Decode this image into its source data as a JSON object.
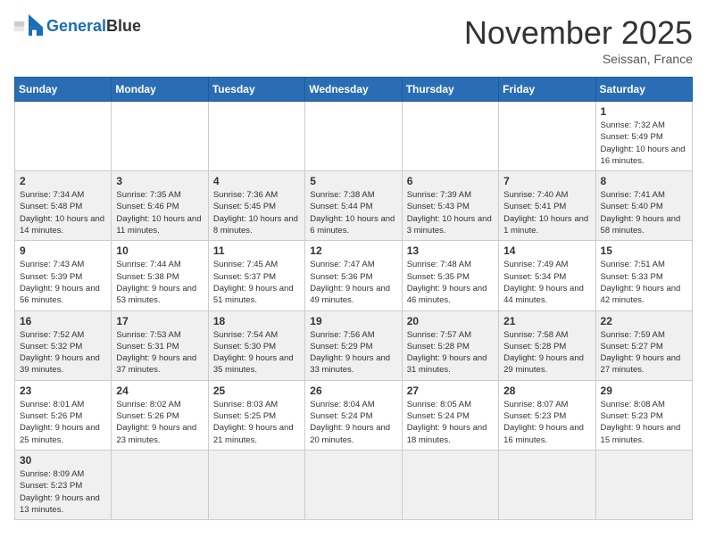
{
  "logo": {
    "general": "General",
    "blue": "Blue"
  },
  "title": "November 2025",
  "location": "Seissan, France",
  "days_of_week": [
    "Sunday",
    "Monday",
    "Tuesday",
    "Wednesday",
    "Thursday",
    "Friday",
    "Saturday"
  ],
  "weeks": [
    [
      {
        "day": "",
        "info": ""
      },
      {
        "day": "",
        "info": ""
      },
      {
        "day": "",
        "info": ""
      },
      {
        "day": "",
        "info": ""
      },
      {
        "day": "",
        "info": ""
      },
      {
        "day": "",
        "info": ""
      },
      {
        "day": "1",
        "info": "Sunrise: 7:32 AM\nSunset: 5:49 PM\nDaylight: 10 hours and 16 minutes."
      }
    ],
    [
      {
        "day": "2",
        "info": "Sunrise: 7:34 AM\nSunset: 5:48 PM\nDaylight: 10 hours and 14 minutes."
      },
      {
        "day": "3",
        "info": "Sunrise: 7:35 AM\nSunset: 5:46 PM\nDaylight: 10 hours and 11 minutes."
      },
      {
        "day": "4",
        "info": "Sunrise: 7:36 AM\nSunset: 5:45 PM\nDaylight: 10 hours and 8 minutes."
      },
      {
        "day": "5",
        "info": "Sunrise: 7:38 AM\nSunset: 5:44 PM\nDaylight: 10 hours and 6 minutes."
      },
      {
        "day": "6",
        "info": "Sunrise: 7:39 AM\nSunset: 5:43 PM\nDaylight: 10 hours and 3 minutes."
      },
      {
        "day": "7",
        "info": "Sunrise: 7:40 AM\nSunset: 5:41 PM\nDaylight: 10 hours and 1 minute."
      },
      {
        "day": "8",
        "info": "Sunrise: 7:41 AM\nSunset: 5:40 PM\nDaylight: 9 hours and 58 minutes."
      }
    ],
    [
      {
        "day": "9",
        "info": "Sunrise: 7:43 AM\nSunset: 5:39 PM\nDaylight: 9 hours and 56 minutes."
      },
      {
        "day": "10",
        "info": "Sunrise: 7:44 AM\nSunset: 5:38 PM\nDaylight: 9 hours and 53 minutes."
      },
      {
        "day": "11",
        "info": "Sunrise: 7:45 AM\nSunset: 5:37 PM\nDaylight: 9 hours and 51 minutes."
      },
      {
        "day": "12",
        "info": "Sunrise: 7:47 AM\nSunset: 5:36 PM\nDaylight: 9 hours and 49 minutes."
      },
      {
        "day": "13",
        "info": "Sunrise: 7:48 AM\nSunset: 5:35 PM\nDaylight: 9 hours and 46 minutes."
      },
      {
        "day": "14",
        "info": "Sunrise: 7:49 AM\nSunset: 5:34 PM\nDaylight: 9 hours and 44 minutes."
      },
      {
        "day": "15",
        "info": "Sunrise: 7:51 AM\nSunset: 5:33 PM\nDaylight: 9 hours and 42 minutes."
      }
    ],
    [
      {
        "day": "16",
        "info": "Sunrise: 7:52 AM\nSunset: 5:32 PM\nDaylight: 9 hours and 39 minutes."
      },
      {
        "day": "17",
        "info": "Sunrise: 7:53 AM\nSunset: 5:31 PM\nDaylight: 9 hours and 37 minutes."
      },
      {
        "day": "18",
        "info": "Sunrise: 7:54 AM\nSunset: 5:30 PM\nDaylight: 9 hours and 35 minutes."
      },
      {
        "day": "19",
        "info": "Sunrise: 7:56 AM\nSunset: 5:29 PM\nDaylight: 9 hours and 33 minutes."
      },
      {
        "day": "20",
        "info": "Sunrise: 7:57 AM\nSunset: 5:28 PM\nDaylight: 9 hours and 31 minutes."
      },
      {
        "day": "21",
        "info": "Sunrise: 7:58 AM\nSunset: 5:28 PM\nDaylight: 9 hours and 29 minutes."
      },
      {
        "day": "22",
        "info": "Sunrise: 7:59 AM\nSunset: 5:27 PM\nDaylight: 9 hours and 27 minutes."
      }
    ],
    [
      {
        "day": "23",
        "info": "Sunrise: 8:01 AM\nSunset: 5:26 PM\nDaylight: 9 hours and 25 minutes."
      },
      {
        "day": "24",
        "info": "Sunrise: 8:02 AM\nSunset: 5:26 PM\nDaylight: 9 hours and 23 minutes."
      },
      {
        "day": "25",
        "info": "Sunrise: 8:03 AM\nSunset: 5:25 PM\nDaylight: 9 hours and 21 minutes."
      },
      {
        "day": "26",
        "info": "Sunrise: 8:04 AM\nSunset: 5:24 PM\nDaylight: 9 hours and 20 minutes."
      },
      {
        "day": "27",
        "info": "Sunrise: 8:05 AM\nSunset: 5:24 PM\nDaylight: 9 hours and 18 minutes."
      },
      {
        "day": "28",
        "info": "Sunrise: 8:07 AM\nSunset: 5:23 PM\nDaylight: 9 hours and 16 minutes."
      },
      {
        "day": "29",
        "info": "Sunrise: 8:08 AM\nSunset: 5:23 PM\nDaylight: 9 hours and 15 minutes."
      }
    ],
    [
      {
        "day": "30",
        "info": "Sunrise: 8:09 AM\nSunset: 5:23 PM\nDaylight: 9 hours and 13 minutes."
      },
      {
        "day": "",
        "info": ""
      },
      {
        "day": "",
        "info": ""
      },
      {
        "day": "",
        "info": ""
      },
      {
        "day": "",
        "info": ""
      },
      {
        "day": "",
        "info": ""
      },
      {
        "day": "",
        "info": ""
      }
    ]
  ]
}
